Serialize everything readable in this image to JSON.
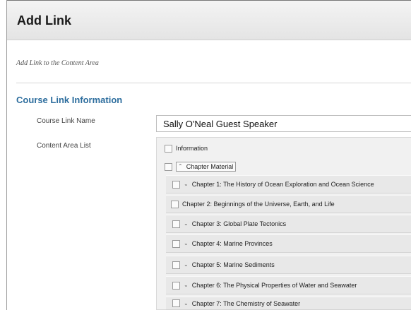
{
  "page": {
    "title": "Add Link",
    "instructions": "Add Link to the Content Area"
  },
  "section": {
    "title": "Course Link Information"
  },
  "form": {
    "course_link_name_label": "Course Link Name",
    "course_link_name_value": "Sally O'Neal Guest Speaker",
    "content_area_list_label": "Content Area List"
  },
  "content_area_list": {
    "top_item": "Information",
    "folder": "Chapter Material",
    "chapters": [
      {
        "label": "Chapter 1: The History of Ocean Exploration and Ocean Science",
        "icon": "chevron-down"
      },
      {
        "label": "Chapter 2: Beginnings of the Universe, Earth, and Life",
        "icon": ""
      },
      {
        "label": "Chapter 3: Global Plate Tectonics",
        "icon": "chevron-down"
      },
      {
        "label": "Chapter 4: Marine Provinces",
        "icon": "chevron-down"
      },
      {
        "label": "Chapter 5: Marine Sediments",
        "icon": "chevron-down"
      },
      {
        "label": "Chapter 6: The Physical Properties of Water and Seawater",
        "icon": "chevron-down"
      },
      {
        "label": "Chapter 7: The Chemistry of Seawater",
        "icon": "chevron-down"
      }
    ]
  }
}
